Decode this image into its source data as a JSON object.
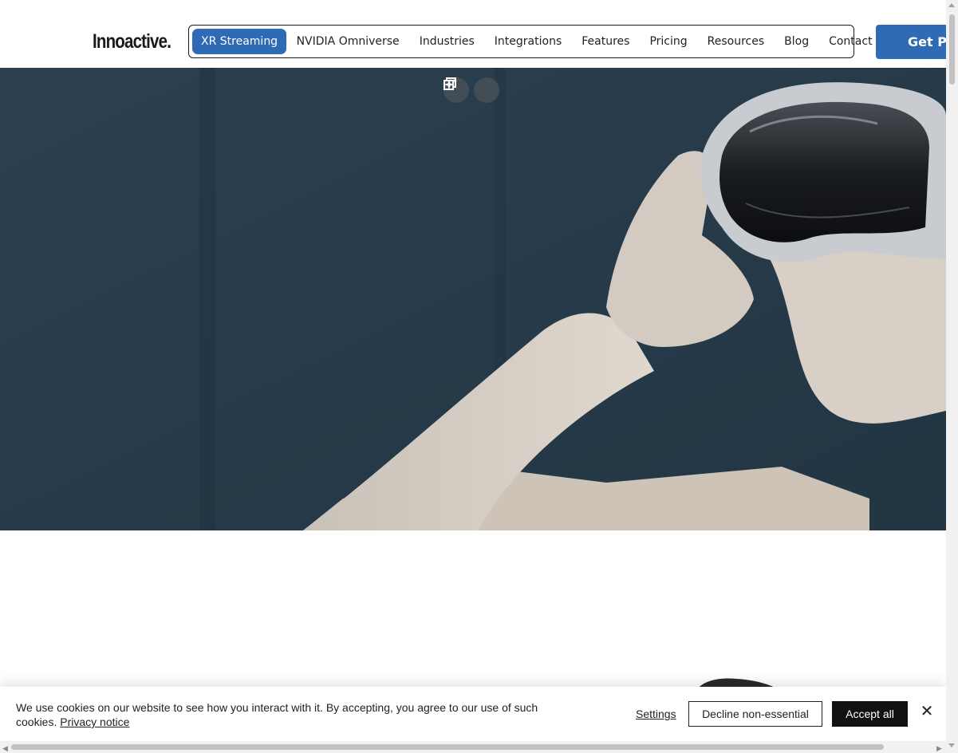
{
  "header": {
    "logo": "Innoactive.",
    "nav": [
      {
        "label": "XR Streaming",
        "active": true
      },
      {
        "label": "NVIDIA Omniverse"
      },
      {
        "label": "Industries"
      },
      {
        "label": "Integrations"
      },
      {
        "label": "Features"
      },
      {
        "label": "Pricing"
      },
      {
        "label": "Resources"
      },
      {
        "label": "Blog"
      },
      {
        "label": "Contact"
      }
    ],
    "cta_label": "Get Po"
  },
  "hero": {
    "tools": [
      "copy-image-icon",
      "sparkle-icon"
    ]
  },
  "cookie_banner": {
    "text": "We use cookies on our website to see how you interact with it. By accepting, you agree to our use of such cookies.",
    "privacy_link": "Privacy notice",
    "settings_label": "Settings",
    "decline_label": "Decline non-essential",
    "accept_label": "Accept all",
    "close_symbol": "✕"
  },
  "colors": {
    "brand_blue": "#2f6ab5",
    "hero_bg": "#2a3e4c",
    "accept_bg": "#111111"
  }
}
